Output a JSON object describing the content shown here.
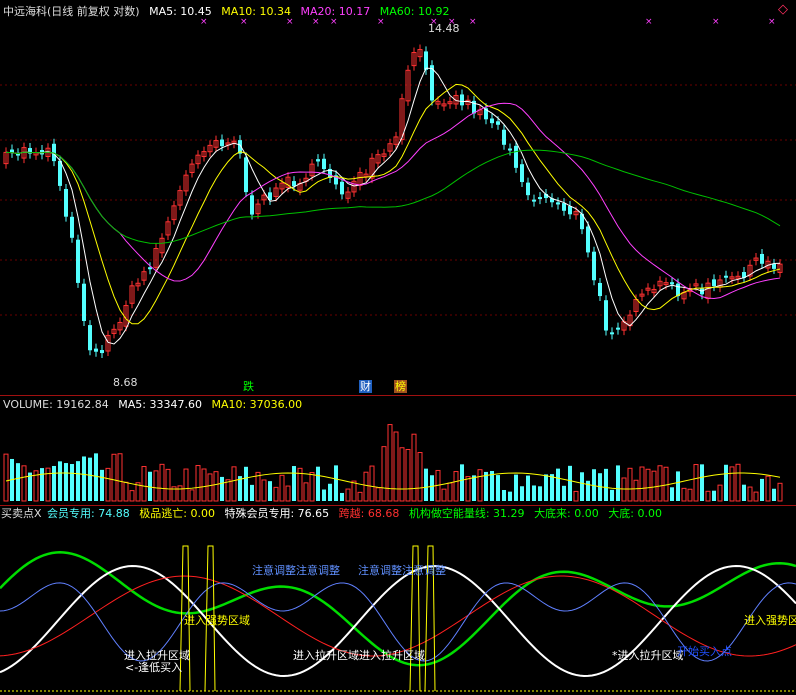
{
  "main": {
    "title": "中远海科(日线 前复权 对数)",
    "ma5": "MA5: 10.45",
    "ma10": "MA10: 10.34",
    "ma20": "MA20: 10.17",
    "ma60": "MA60: 10.92",
    "high_label": "14.48",
    "low_label": "8.68",
    "events": [
      "跌",
      "财",
      "榜"
    ],
    "colors": {
      "ma5": "#ffffff",
      "ma10": "#ffff00",
      "ma20": "#ff00ff",
      "ma60": "#00ff00",
      "up": "#ff3232",
      "down": "#54ffff"
    }
  },
  "volume": {
    "label": "VOLUME: 19162.84",
    "ma5": "MA5: 33347.60",
    "ma10": "MA10: 37036.00"
  },
  "indicator": {
    "name": "买卖点X",
    "member": "会员专用: 74.88",
    "escape": "极品逃亡: 0.00",
    "special": "特殊会员专用: 76.65",
    "cross": "跨越: 68.68",
    "inst": "机构做空能量线: 31.29",
    "bottom_coming": "大底来: 0.00",
    "bottom": "大底: 0.00",
    "notes": {
      "adjust1": "注意调整注意调整",
      "adjust2": "注意调整注意调整",
      "strong_zone": "进入强势区域",
      "strong_zone_right": "进入强势区",
      "pull_zone1": "进入拉升区域",
      "low_buy": "<-逢低买入",
      "pull_zone2": "进入拉升区域进入拉升区域",
      "pull_zone3": "*进入拉升区域",
      "buy_point": "开始买入点"
    }
  }
}
